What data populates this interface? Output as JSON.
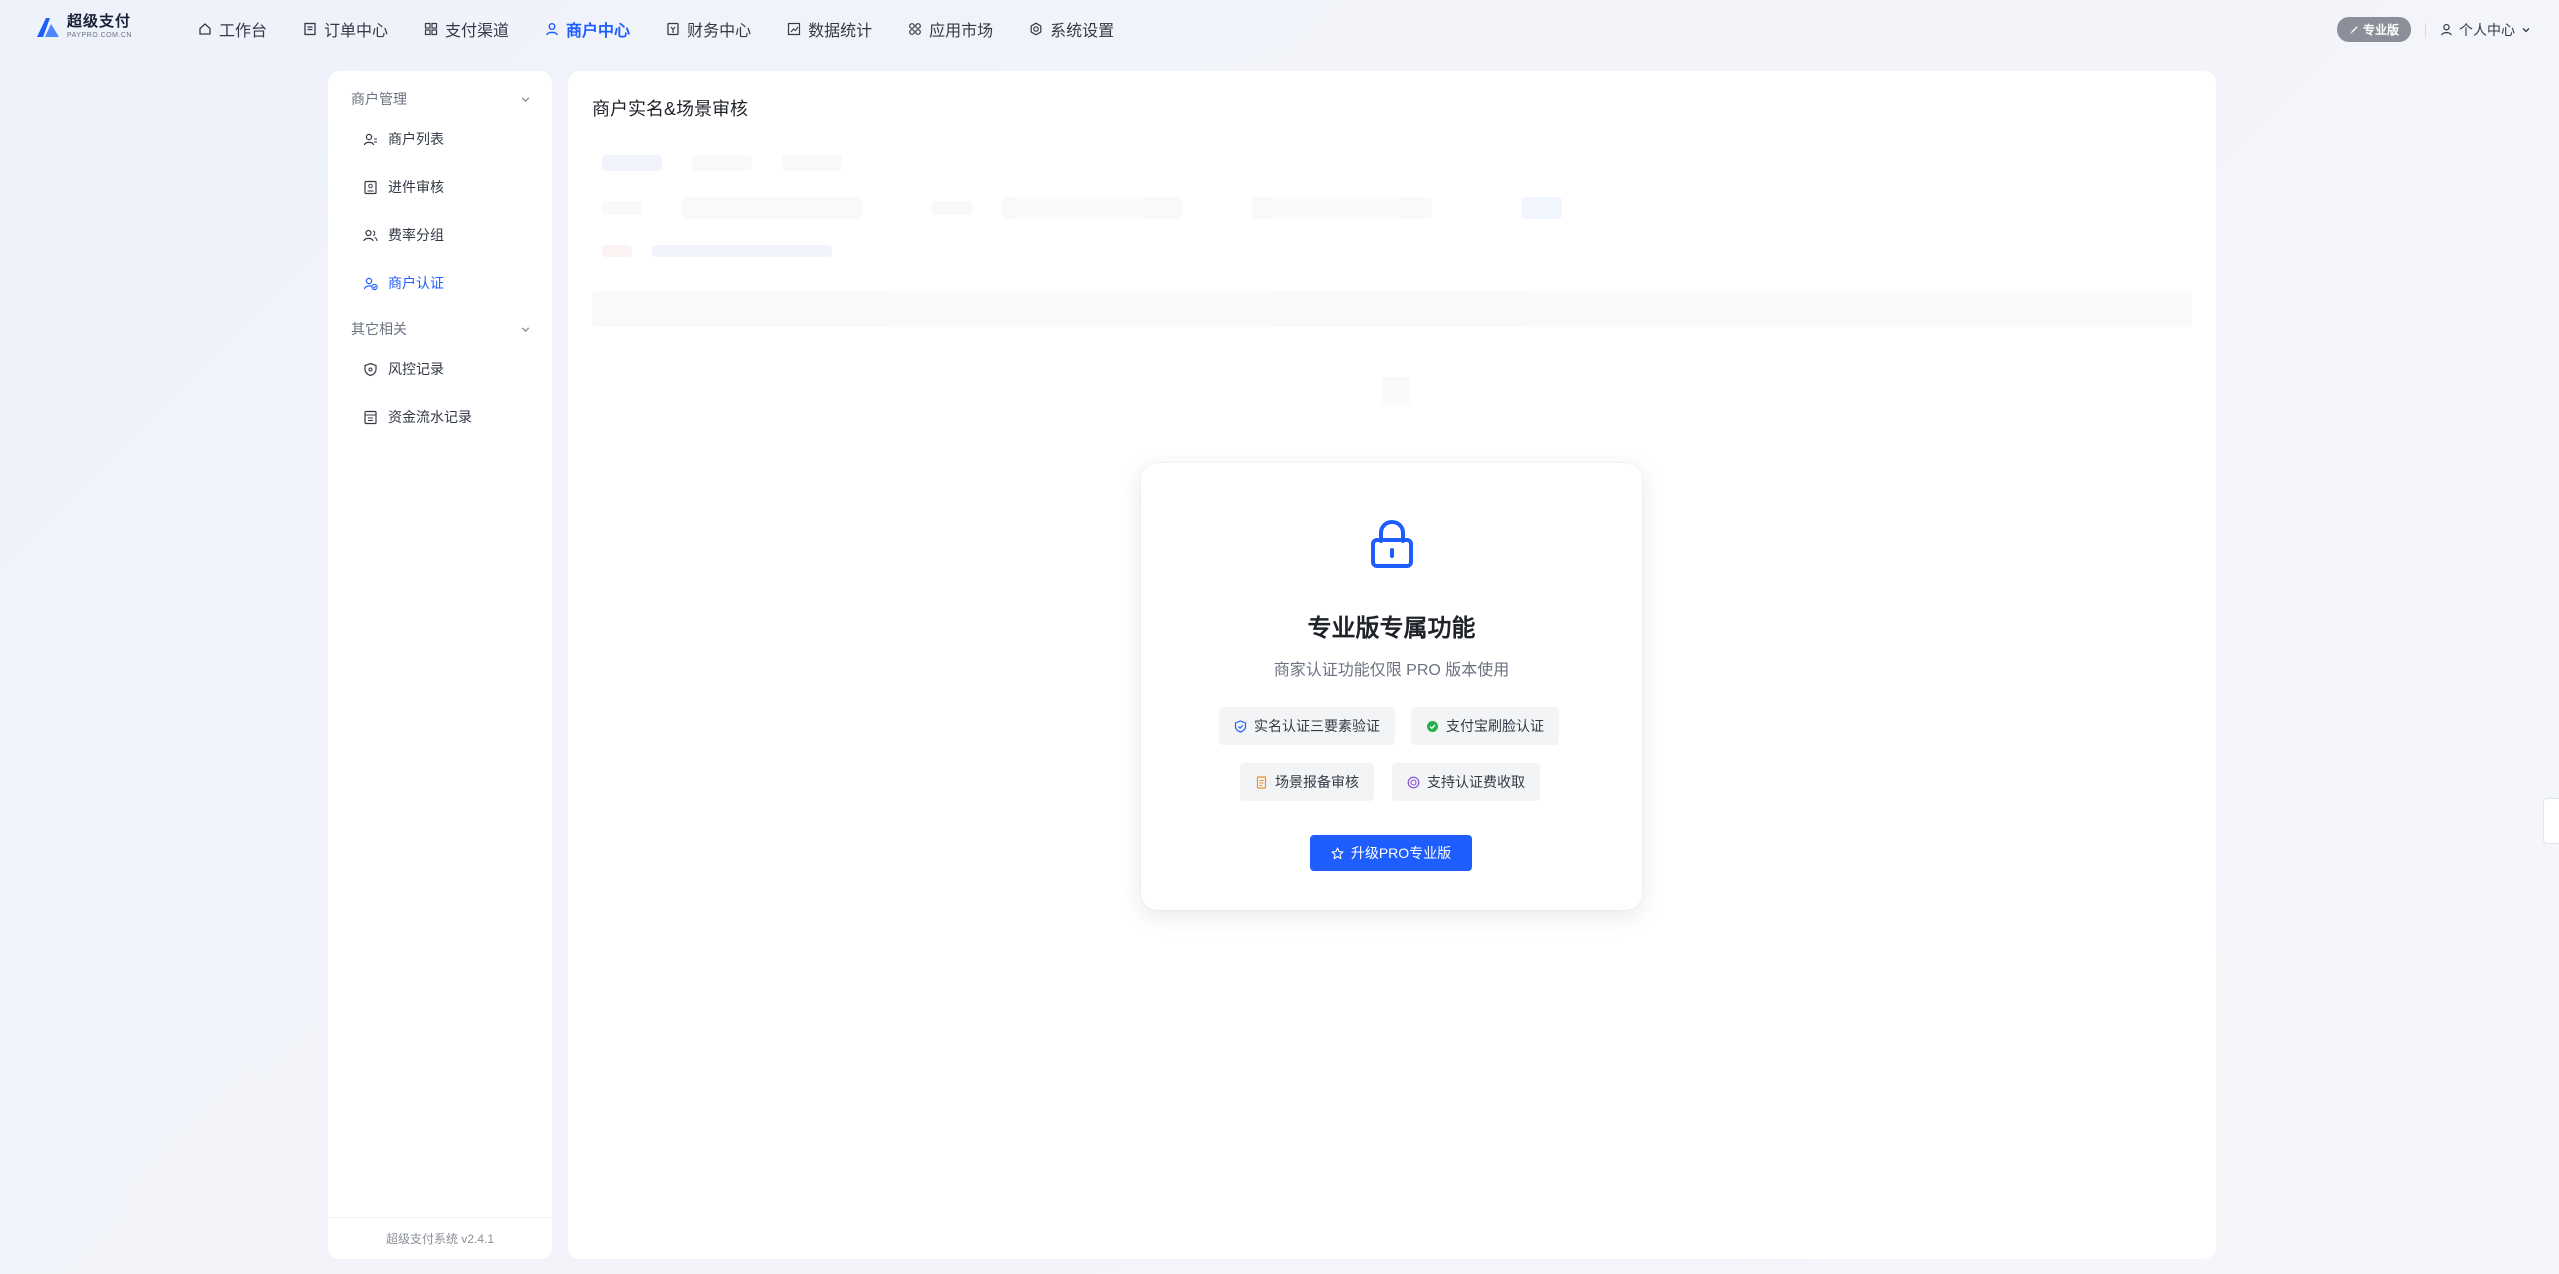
{
  "brand": {
    "title": "超级支付",
    "subtitle": "PAYPRO.COM.CN"
  },
  "nav": {
    "items": [
      {
        "label": "工作台",
        "icon": "home-icon"
      },
      {
        "label": "订单中心",
        "icon": "order-icon"
      },
      {
        "label": "支付渠道",
        "icon": "grid-icon"
      },
      {
        "label": "商户中心",
        "icon": "merchant-icon",
        "active": true
      },
      {
        "label": "财务中心",
        "icon": "finance-icon"
      },
      {
        "label": "数据统计",
        "icon": "chart-icon"
      },
      {
        "label": "应用市场",
        "icon": "apps-icon"
      },
      {
        "label": "系统设置",
        "icon": "gear-icon"
      }
    ]
  },
  "header": {
    "pro_badge": "专业版",
    "user_center": "个人中心"
  },
  "sidebar": {
    "group1": "商户管理",
    "items1": [
      "商户列表",
      "进件审核",
      "费率分组",
      "商户认证"
    ],
    "group2": "其它相关",
    "items2": [
      "风控记录",
      "资金流水记录"
    ],
    "footer": "超级支付系统 v2.4.1"
  },
  "main": {
    "title": "商户实名&场景审核"
  },
  "lock_card": {
    "title": "专业版专属功能",
    "subtitle": "商家认证功能仅限 PRO 版本使用",
    "features": [
      "实名认证三要素验证",
      "支付宝刷脸认证",
      "场景报备审核",
      "支持认证费收取"
    ],
    "button": "升级PRO专业版"
  },
  "colors": {
    "accent": "#1e5eff",
    "badge": "#8a8f99"
  }
}
